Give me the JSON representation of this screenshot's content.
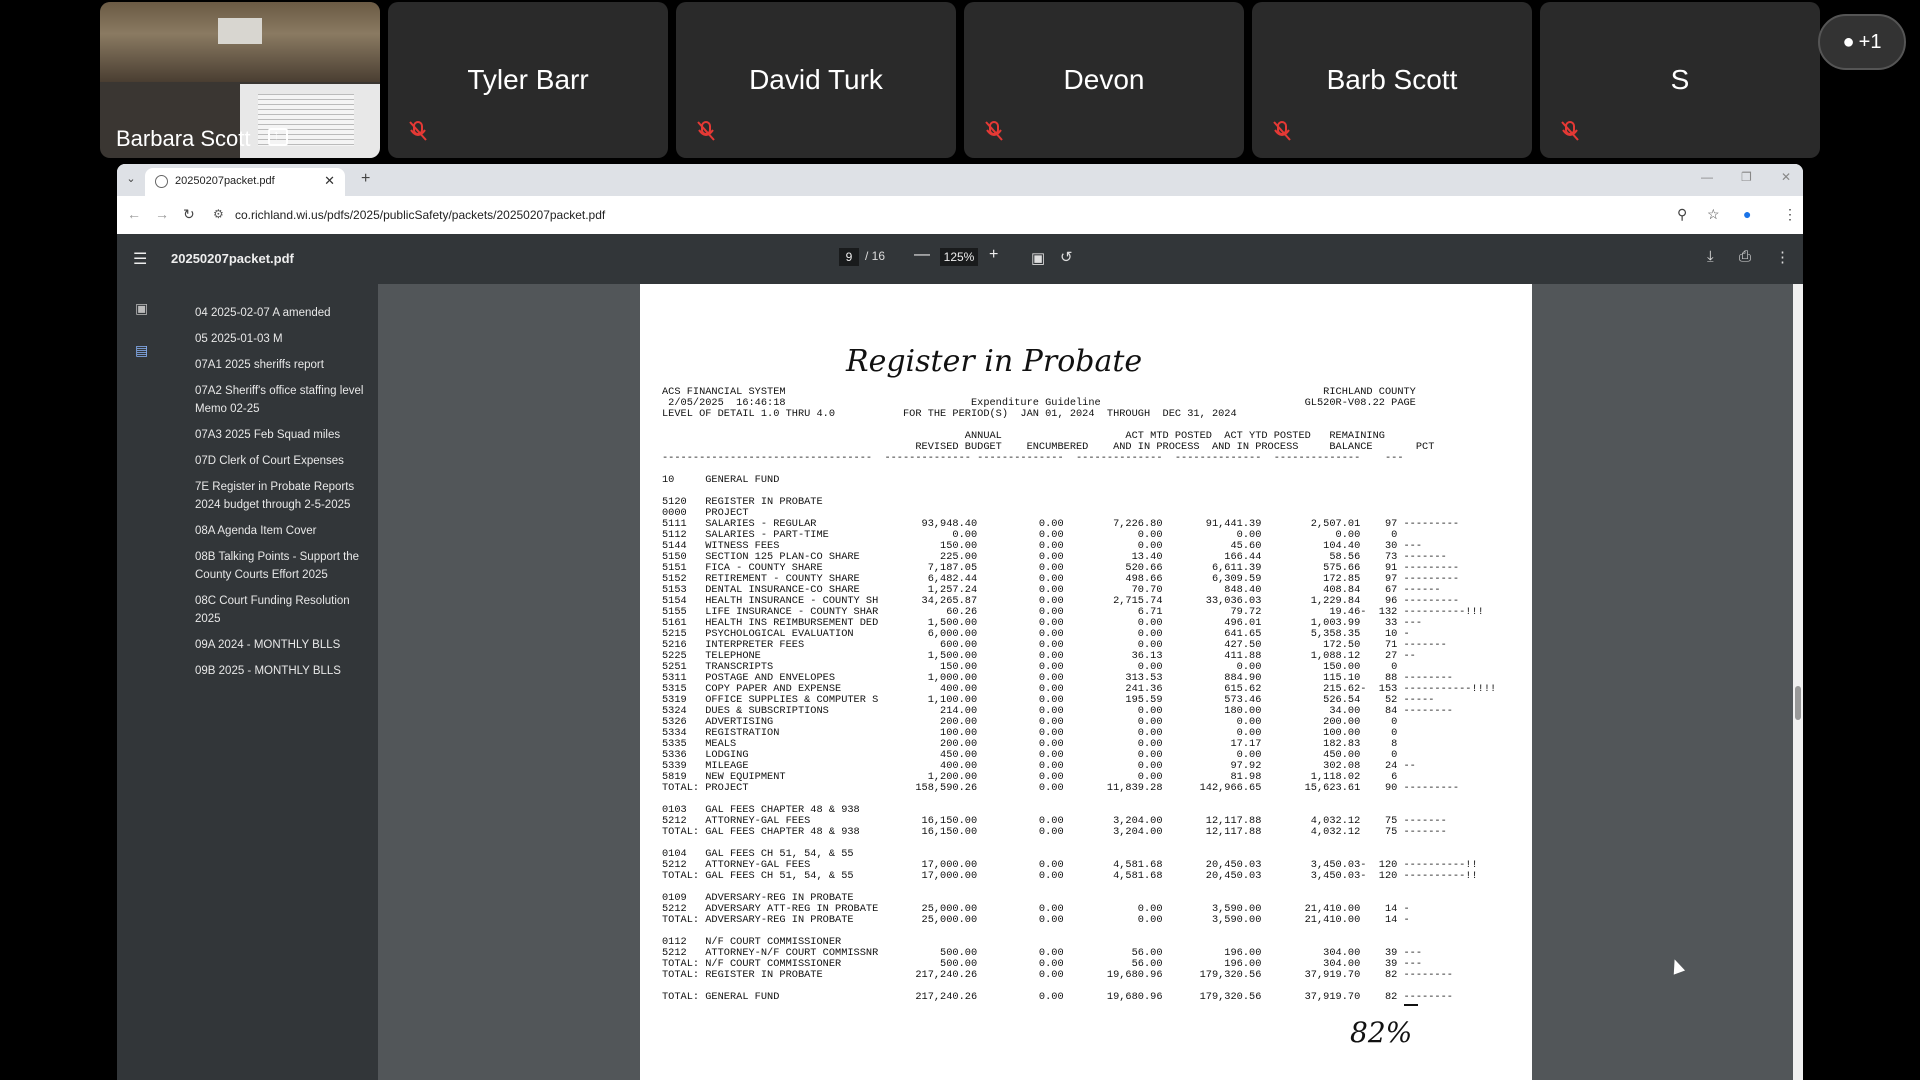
{
  "meeting": {
    "presenter": "Barbara Scott",
    "participants": [
      "Tyler Barr",
      "David Turk",
      "Devon",
      "Barb Scott",
      "S"
    ],
    "more_count": "+1"
  },
  "browser": {
    "tab_title": "20250207packet.pdf",
    "url": "co.richland.wi.us/pdfs/2025/publicSafety/packets/20250207packet.pdf"
  },
  "pdf": {
    "filename": "20250207packet.pdf",
    "page_current": "9",
    "page_total": "/ 16",
    "zoom": "125%",
    "outline": [
      "04 2025-02-07 A amended",
      "05 2025-01-03 M",
      "07A1 2025 sheriffs report",
      "07A2 Sheriff's office staffing level Memo 02-25",
      "07A3 2025 Feb Squad miles",
      "07D Clerk of Court Expenses",
      "7E Register in Probate Reports 2024 budget through 2-5-2025",
      "08A Agenda Item Cover",
      "08B Talking Points - Support the County Courts Effort 2025",
      "08C Court Funding Resolution 2025",
      "09A 2024 - MONTHLY BLLS",
      "09B 2025 - MONTHLY BLLS"
    ]
  },
  "document": {
    "handwritten_title": "Register in Probate",
    "handwritten_note": "82%",
    "report_text": "ACS FINANCIAL SYSTEM                                                                                       RICHLAND COUNTY\n 2/05/2025  16:46:18                              Expenditure Guideline                                 GL520R-V08.22 PAGE\nLEVEL OF DETAIL 1.0 THRU 4.0           FOR THE PERIOD(S)  JAN 01, 2024  THROUGH  DEC 31, 2024\n\n                                                 ANNUAL                    ACT MTD POSTED  ACT YTD POSTED   REMAINING\n                                         REVISED BUDGET    ENCUMBERED    AND IN PROCESS  AND IN PROCESS     BALANCE       PCT\n----------------------------------  -------------- --------------  --------------  --------------  --------------    ---\n\n10     GENERAL FUND\n\n5120   REGISTER IN PROBATE\n0000   PROJECT\n5111   SALARIES - REGULAR                 93,948.40          0.00        7,226.80       91,441.39        2,507.01    97 ---------\n5112   SALARIES - PART-TIME                    0.00          0.00            0.00            0.00            0.00     0\n5144   WITNESS FEES                          150.00          0.00            0.00           45.60          104.40    30 ---\n5150   SECTION 125 PLAN-CO SHARE             225.00          0.00           13.40          166.44           58.56    73 -------\n5151   FICA - COUNTY SHARE                 7,187.05          0.00          520.66        6,611.39          575.66    91 ---------\n5152   RETIREMENT - COUNTY SHARE           6,482.44          0.00          498.66        6,309.59          172.85    97 ---------\n5153   DENTAL INSURANCE-CO SHARE           1,257.24          0.00           70.70          848.40          408.84    67 ------\n5154   HEALTH INSURANCE - COUNTY SH       34,265.87          0.00        2,715.74       33,036.03        1,229.84    96 ---------\n5155   LIFE INSURANCE - COUNTY SHAR           60.26          0.00            6.71           79.72           19.46-  132 ----------!!!\n5161   HEALTH INS REIMBURSEMENT DED        1,500.00          0.00            0.00          496.01        1,003.99    33 ---\n5215   PSYCHOLOGICAL EVALUATION            6,000.00          0.00            0.00          641.65        5,358.35    10 -\n5216   INTERPRETER FEES                      600.00          0.00            0.00          427.50          172.50    71 -------\n5225   TELEPHONE                           1,500.00          0.00           36.13          411.88        1,088.12    27 --\n5251   TRANSCRIPTS                           150.00          0.00            0.00            0.00          150.00     0\n5311   POSTAGE AND ENVELOPES               1,000.00          0.00          313.53          884.90          115.10    88 --------\n5315   COPY PAPER AND EXPENSE                400.00          0.00          241.36          615.62          215.62-  153 -----------!!!!\n5319   OFFICE SUPPLIES & COMPUTER S        1,100.00          0.00          195.59          573.46          526.54    52 -----\n5324   DUES & SUBSCRIPTIONS                  214.00          0.00            0.00          180.00           34.00    84 --------\n5326   ADVERTISING                           200.00          0.00            0.00            0.00          200.00     0\n5334   REGISTRATION                          100.00          0.00            0.00            0.00          100.00     0\n5335   MEALS                                 200.00          0.00            0.00           17.17          182.83     8\n5336   LODGING                               450.00          0.00            0.00            0.00          450.00     0\n5339   MILEAGE                               400.00          0.00            0.00           97.92          302.08    24 --\n5819   NEW EQUIPMENT                       1,200.00          0.00            0.00           81.98        1,118.02     6\nTOTAL: PROJECT                           158,590.26          0.00       11,839.28      142,966.65       15,623.61    90 ---------\n\n0103   GAL FEES CHAPTER 48 & 938\n5212   ATTORNEY-GAL FEES                  16,150.00          0.00        3,204.00       12,117.88        4,032.12    75 -------\nTOTAL: GAL FEES CHAPTER 48 & 938          16,150.00          0.00        3,204.00       12,117.88        4,032.12    75 -------\n\n0104   GAL FEES CH 51, 54, & 55\n5212   ATTORNEY-GAL FEES                  17,000.00          0.00        4,581.68       20,450.03        3,450.03-  120 ----------!!\nTOTAL: GAL FEES CH 51, 54, & 55           17,000.00          0.00        4,581.68       20,450.03        3,450.03-  120 ----------!!\n\n0109   ADVERSARY-REG IN PROBATE\n5212   ADVERSARY ATT-REG IN PROBATE       25,000.00          0.00            0.00        3,590.00       21,410.00    14 -\nTOTAL: ADVERSARY-REG IN PROBATE           25,000.00          0.00            0.00        3,590.00       21,410.00    14 -\n\n0112   N/F COURT COMMISSIONER\n5212   ATTORNEY-N/F COURT COMMISSNR          500.00          0.00           56.00          196.00          304.00    39 ---\nTOTAL: N/F COURT COMMISSIONER                500.00          0.00           56.00          196.00          304.00    39 ---\nTOTAL: REGISTER IN PROBATE               217,240.26          0.00       19,680.96      179,320.56       37,919.70    82 --------\n\nTOTAL: GENERAL FUND                      217,240.26          0.00       19,680.96      179,320.56       37,919.70    82 --------"
  }
}
